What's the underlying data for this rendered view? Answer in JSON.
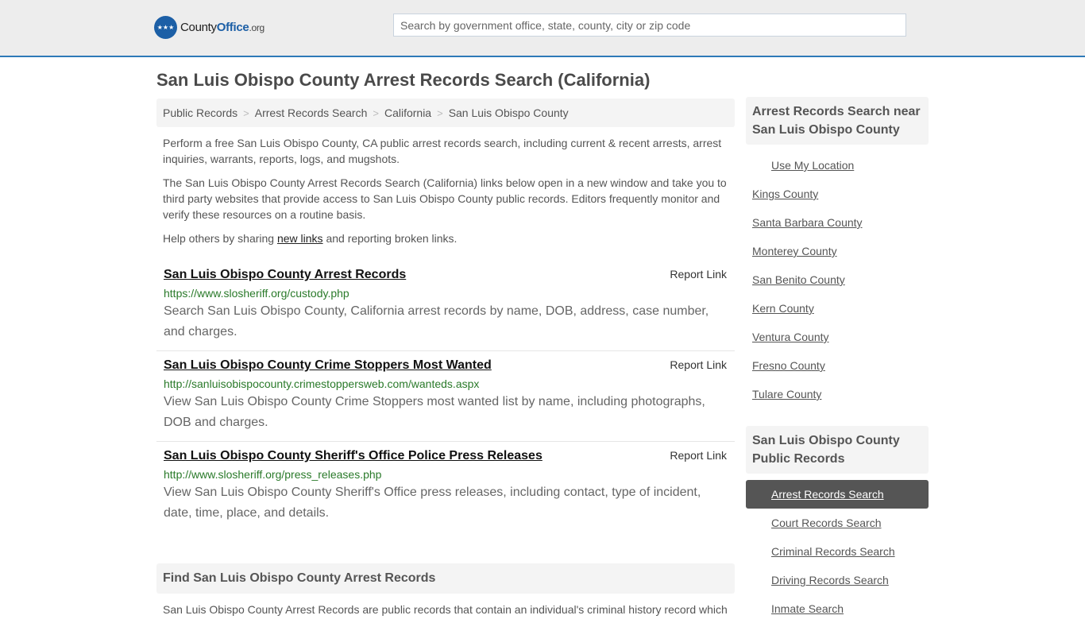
{
  "header": {
    "logo": {
      "name": "County",
      "bold": "Office",
      "tld": ".org",
      "icon": "eagle-stars-badge"
    },
    "search_placeholder": "Search by government office, state, county, city or zip code",
    "accent_color": "#2e7ab8"
  },
  "page_title": "San Luis Obispo County Arrest Records Search (California)",
  "breadcrumb": [
    {
      "label": "Public Records"
    },
    {
      "label": "Arrest Records Search"
    },
    {
      "label": "California"
    },
    {
      "label": "San Luis Obispo County"
    }
  ],
  "breadcrumb_separator": ">",
  "intro": {
    "p1": "Perform a free San Luis Obispo County, CA public arrest records search, including current & recent arrests, arrest inquiries, warrants, reports, logs, and mugshots.",
    "p2": "The San Luis Obispo County Arrest Records Search (California) links below open in a new window and take you to third party websites that provide access to San Luis Obispo County public records. Editors frequently monitor and verify these resources on a routine basis.",
    "p3_before": "Help others by sharing ",
    "p3_link": "new links",
    "p3_after": " and reporting broken links."
  },
  "results": [
    {
      "title": "San Luis Obispo County Arrest Records",
      "report": "Report Link",
      "url": "https://www.slosheriff.org/custody.php",
      "desc": "Search San Luis Obispo County, California arrest records by name, DOB, address, case number, and charges."
    },
    {
      "title": "San Luis Obispo County Crime Stoppers Most Wanted",
      "report": "Report Link",
      "url": "http://sanluisobispocounty.crimestoppersweb.com/wanteds.aspx",
      "desc": "View San Luis Obispo County Crime Stoppers most wanted list by name, including photographs, DOB and charges."
    },
    {
      "title": "San Luis Obispo County Sheriff's Office Police Press Releases",
      "report": "Report Link",
      "url": "http://www.slosheriff.org/press_releases.php",
      "desc": "View San Luis Obispo County Sheriff's Office press releases, including contact, type of incident, date, time, place, and details."
    }
  ],
  "find_section": {
    "heading": "Find San Luis Obispo County Arrest Records",
    "text": "San Luis Obispo County Arrest Records are public records that contain an individual's criminal history record which"
  },
  "sidebar": {
    "near": {
      "heading": "Arrest Records Search near San Luis Obispo County",
      "use_location": "Use My Location",
      "items": [
        "Kings County",
        "Santa Barbara County",
        "Monterey County",
        "San Benito County",
        "Kern County",
        "Ventura County",
        "Fresno County",
        "Tulare County"
      ]
    },
    "records": {
      "heading": "San Luis Obispo County Public Records",
      "active": "Arrest Records Search",
      "items": [
        "Arrest Records Search",
        "Court Records Search",
        "Criminal Records Search",
        "Driving Records Search",
        "Inmate Search"
      ]
    }
  }
}
